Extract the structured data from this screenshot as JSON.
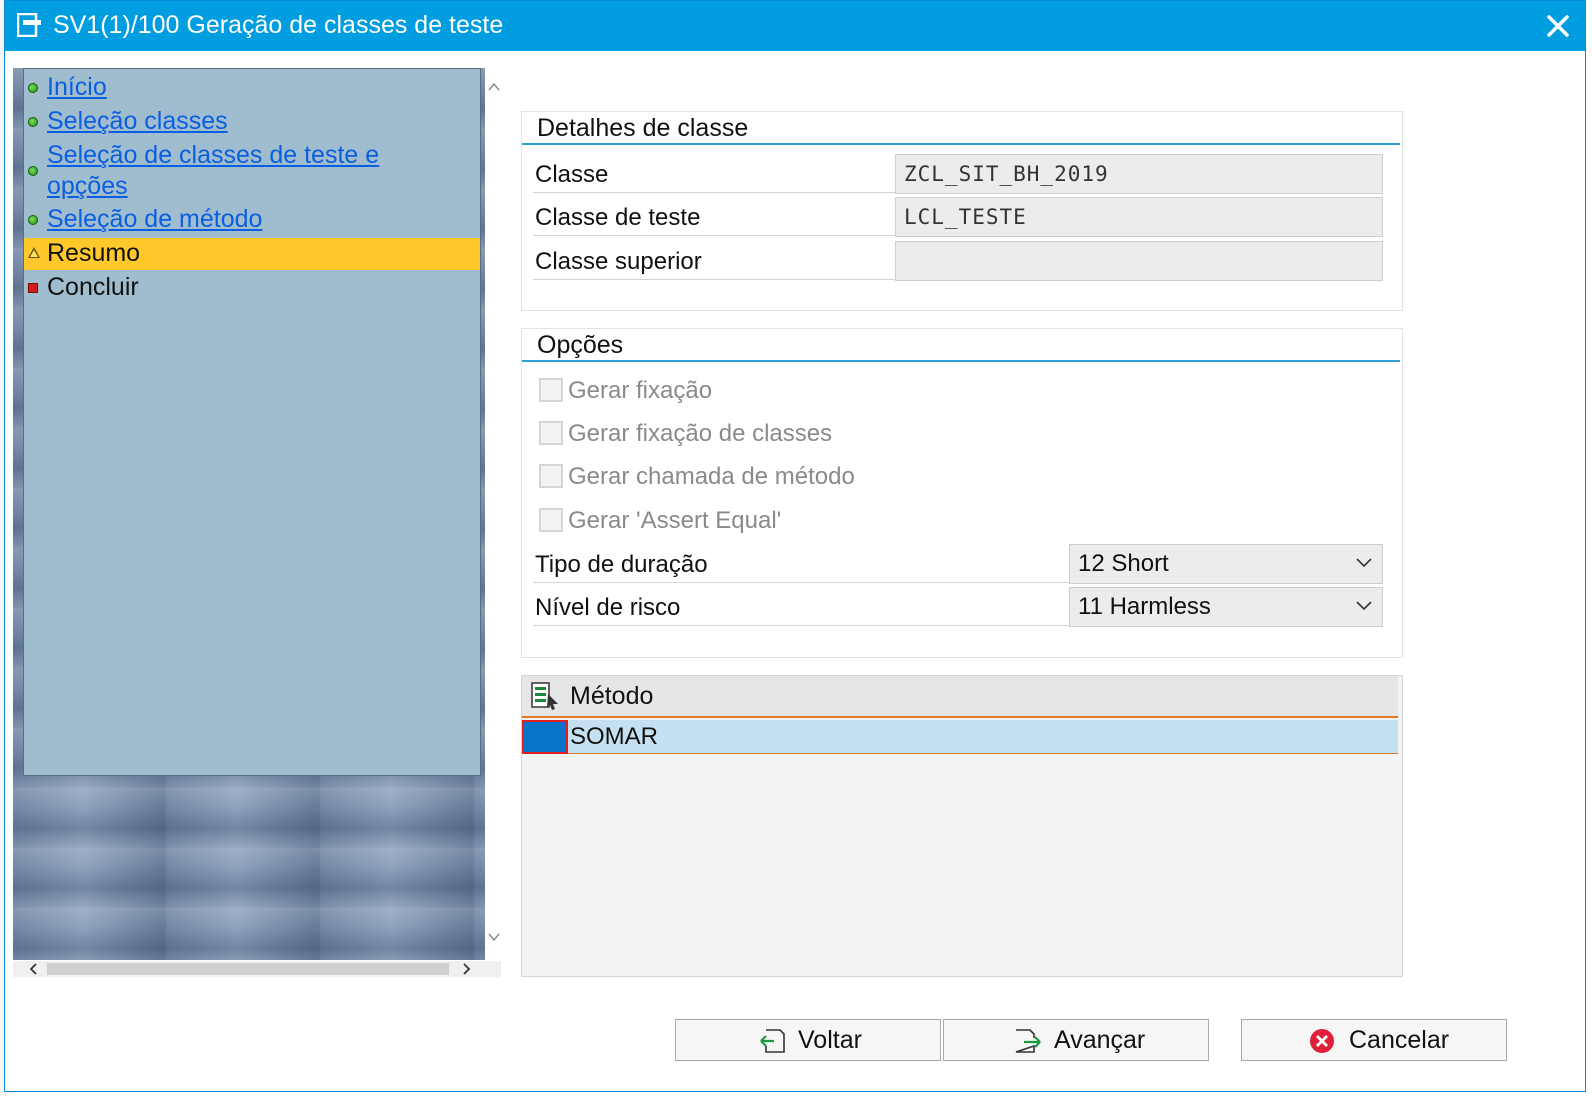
{
  "window": {
    "title": "SV1(1)/100 Geração de classes de teste",
    "title_icon": "dialog-icon",
    "close_icon": "close-icon"
  },
  "nav": {
    "items": [
      {
        "label": "Início",
        "status": "green",
        "link": true
      },
      {
        "label": "Seleção classes",
        "status": "green",
        "link": true
      },
      {
        "label_line1": "Seleção de classes de teste e",
        "label_line2": "opções",
        "status": "green",
        "link": true
      },
      {
        "label": "Seleção de método",
        "status": "green",
        "link": true
      },
      {
        "label": "Resumo",
        "status": "warning",
        "link": false,
        "current": true
      },
      {
        "label": "Concluir",
        "status": "red",
        "link": false
      }
    ]
  },
  "class_details": {
    "title": "Detalhes de classe",
    "rows": [
      {
        "label": "Classe",
        "value": "ZCL_SIT_BH_2019"
      },
      {
        "label": "Classe de teste",
        "value": "LCL_TESTE"
      },
      {
        "label": "Classe superior",
        "value": ""
      }
    ]
  },
  "options": {
    "title": "Opções",
    "checkboxes": [
      {
        "label": "Gerar fixação",
        "checked": false,
        "enabled": false
      },
      {
        "label": "Gerar fixação de classes",
        "checked": false,
        "enabled": false
      },
      {
        "label": "Gerar chamada de método",
        "checked": false,
        "enabled": false
      },
      {
        "label": "Gerar 'Assert Equal'",
        "checked": false,
        "enabled": false
      }
    ],
    "duration": {
      "label": "Tipo de duração",
      "value": "12 Short"
    },
    "risk": {
      "label": "Nível de risco",
      "value": "11 Harmless"
    }
  },
  "methods": {
    "header": "Método",
    "rows": [
      "SOMAR"
    ]
  },
  "buttons": {
    "back": "Voltar",
    "next": "Avançar",
    "cancel": "Cancelar"
  },
  "colors": {
    "titlebar": "#009de0",
    "accent_line": "#2c9fd9",
    "current_step": "#ffc92b",
    "selected_row": "#c5e1f1"
  }
}
